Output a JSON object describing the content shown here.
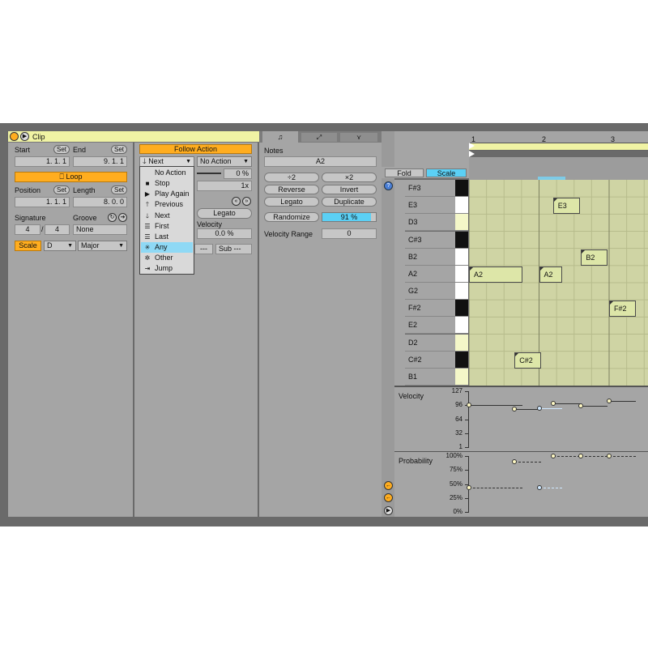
{
  "colors": {
    "accent_orange": "#ffad1f",
    "highlight_blue": "#5bd0f5",
    "note_fill": "#dde6a8",
    "panel_gray": "#a5a5a5"
  },
  "clip": {
    "title": "Clip",
    "start_label": "Start",
    "end_label": "End",
    "set_label": "Set",
    "start_value": "1.  1.  1",
    "end_value": "9.  1.  1",
    "loop_label": "Loop",
    "position_label": "Position",
    "length_label": "Length",
    "position_value": "1.  1.  1",
    "length_value": "8.  0.  0",
    "signature_label": "Signature",
    "groove_label": "Groove",
    "sig_num": "4",
    "sig_den": "4",
    "groove_value": "None",
    "scale_button": "Scale",
    "scale_root": "D",
    "scale_mode": "Major"
  },
  "follow": {
    "title": "Follow Action",
    "action_a": "Next",
    "action_b": "No Action",
    "chance": "0 %",
    "multiplier": "1x",
    "legato": "Legato",
    "velocity_label": "Velocity",
    "velocity_value": "0.0 %",
    "sub_label": "Sub ---",
    "dash_label": "---",
    "menu": [
      {
        "icon": "",
        "label": "No Action"
      },
      {
        "icon": "■",
        "label": "Stop"
      },
      {
        "icon": "▶",
        "label": "Play Again"
      },
      {
        "icon": "🡑",
        "label": "Previous"
      },
      {
        "icon": "🡓",
        "label": "Next"
      },
      {
        "icon": "☰",
        "label": "First"
      },
      {
        "icon": "☰",
        "label": "Last"
      },
      {
        "icon": "✳",
        "label": "Any"
      },
      {
        "icon": "✲",
        "label": "Other"
      },
      {
        "icon": "⇥",
        "label": "Jump"
      }
    ]
  },
  "notes": {
    "title": "Notes",
    "name": "A2",
    "div2": "÷2",
    "mul2": "×2",
    "reverse": "Reverse",
    "invert": "Invert",
    "legato": "Legato",
    "duplicate": "Duplicate",
    "randomize": "Randomize",
    "randomize_value": "91 %",
    "velocity_range_label": "Velocity Range",
    "velocity_range_value": "0"
  },
  "editor": {
    "fold": "Fold",
    "scale": "Scale",
    "bars": [
      "1",
      "2",
      "3"
    ],
    "key_rows": [
      "F#3",
      "E3",
      "D3",
      "C#3",
      "B2",
      "A2",
      "G2",
      "F#2",
      "E2",
      "D2",
      "C#2",
      "B1"
    ],
    "notes": [
      {
        "label": "E3",
        "row": 1,
        "bar": 2.2,
        "length": 0.38
      },
      {
        "label": "B2",
        "row": 4,
        "bar": 2.6,
        "length": 0.38
      },
      {
        "label": "A2",
        "row": 5,
        "bar": 1.0,
        "length": 0.76
      },
      {
        "label": "A2",
        "row": 5,
        "bar": 2.0,
        "length": 0.33
      },
      {
        "label": "F#2",
        "row": 7,
        "bar": 3.0,
        "length": 0.38
      },
      {
        "label": "C#2",
        "row": 10,
        "bar": 1.65,
        "length": 0.38
      }
    ],
    "velocity_label": "Velocity",
    "velocity_ticks": [
      "127",
      "96",
      "64",
      "32",
      "1"
    ],
    "velocity_values": [
      {
        "bar": 1.0,
        "value": 96
      },
      {
        "bar": 1.65,
        "value": 86
      },
      {
        "bar": 2.0,
        "value": 89
      },
      {
        "bar": 2.2,
        "value": 99
      },
      {
        "bar": 2.6,
        "value": 94
      },
      {
        "bar": 3.0,
        "value": 106
      }
    ],
    "probability_label": "Probability",
    "probability_ticks": [
      "100%",
      "75%",
      "50%",
      "25%",
      "0%"
    ],
    "probability_values": [
      {
        "bar": 1.0,
        "value": 44
      },
      {
        "bar": 1.65,
        "value": 90
      },
      {
        "bar": 2.0,
        "value": 44
      },
      {
        "bar": 2.2,
        "value": 100
      },
      {
        "bar": 2.6,
        "value": 100
      },
      {
        "bar": 3.0,
        "value": 100
      }
    ]
  }
}
